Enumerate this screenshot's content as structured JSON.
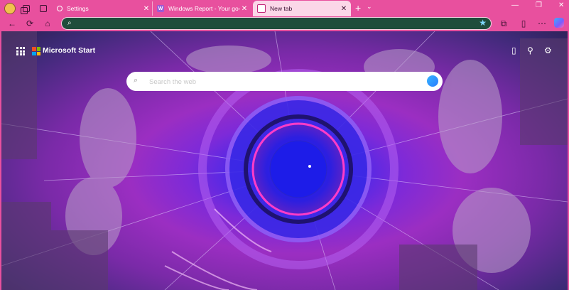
{
  "tabs": [
    {
      "title": "Settings",
      "close": "✕"
    },
    {
      "title": "Windows Report - Your go-to so",
      "close": "✕",
      "favicon_letter": "W"
    },
    {
      "title": "New tab",
      "close": "✕"
    }
  ],
  "tabstrip": {
    "new_tab": "+",
    "dropdown": "⌄"
  },
  "window_controls": {
    "minimize": "—",
    "restore": "❐",
    "close": "✕"
  },
  "toolbar": {
    "back": "←",
    "refresh": "⟳",
    "home": "⌂",
    "extensions": "⧉",
    "split": "▯",
    "collections": "☆",
    "more": "⋯"
  },
  "address_bar": {
    "value": "",
    "placeholder": ""
  },
  "newtab": {
    "brand": "Microsoft Start",
    "search_placeholder": "Search the web",
    "icons": [
      "apps-launcher-icon",
      "mobile-icon",
      "rewards-icon",
      "settings-gear-icon"
    ]
  },
  "colors": {
    "tab_strip": "#e8509e",
    "active_tab": "#fbd7e8",
    "address_bar": "#1f4d3c",
    "ms_red": "#f25022",
    "ms_green": "#7fba00",
    "ms_blue": "#00a4ef",
    "ms_yellow": "#ffb900"
  }
}
